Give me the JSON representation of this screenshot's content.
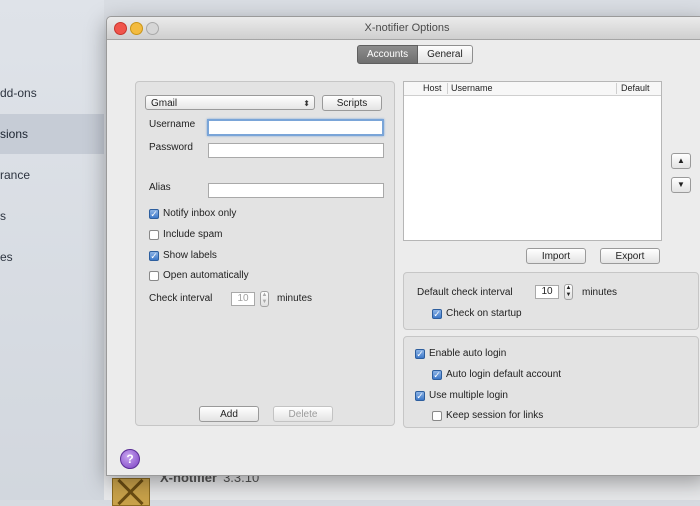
{
  "background": {
    "sidebar_items": [
      "dd-ons",
      "sions",
      "rance",
      "s",
      "es"
    ],
    "addon_name": "X-notifier",
    "addon_version": "3.3.10"
  },
  "window": {
    "title": "X-notifier Options"
  },
  "tabs": [
    {
      "label": "Accounts",
      "active": true
    },
    {
      "label": "General",
      "active": false
    }
  ],
  "account_form": {
    "service_selected": "Gmail",
    "popup_arrows": "⬍",
    "scripts_button": "Scripts",
    "username_label": "Username",
    "username_value": "",
    "password_label": "Password",
    "password_value": "",
    "alias_label": "Alias",
    "alias_value": "",
    "checkboxes": [
      {
        "label": "Notify inbox only",
        "checked": true
      },
      {
        "label": "Include spam",
        "checked": false
      },
      {
        "label": "Show labels",
        "checked": true
      },
      {
        "label": "Open automatically",
        "checked": false
      }
    ],
    "check_interval_label": "Check interval",
    "check_interval_value": "10",
    "check_interval_unit": "minutes",
    "add_button": "Add",
    "delete_button": "Delete"
  },
  "accounts_table": {
    "columns": [
      "Host",
      "Username",
      "Default"
    ],
    "rows": []
  },
  "order_buttons": {
    "up": "▲",
    "down": "▼"
  },
  "import_button": "Import",
  "export_button": "Export",
  "defaults": {
    "check_interval_label": "Default check interval",
    "check_interval_value": "10",
    "check_interval_unit": "minutes",
    "check_on_startup_label": "Check on startup",
    "check_on_startup": true
  },
  "login": {
    "enable_auto_login": {
      "label": "Enable auto login",
      "checked": true
    },
    "auto_login_default": {
      "label": "Auto login default account",
      "checked": true
    },
    "use_multiple_login": {
      "label": "Use multiple login",
      "checked": true
    },
    "keep_session": {
      "label": "Keep session for links",
      "checked": false
    }
  },
  "help_icon_glyph": "?",
  "check_glyph": "✓",
  "stepper_glyphs": {
    "up": "▲",
    "down": "▼"
  }
}
